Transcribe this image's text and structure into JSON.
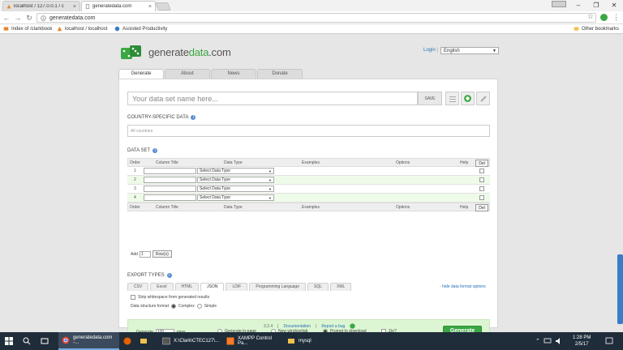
{
  "browser": {
    "tabs": [
      {
        "title": "localhost / 127.0.0.1 / c",
        "close": "×"
      },
      {
        "title": "generatedata.com",
        "close": "×"
      }
    ],
    "window_controls": {
      "minimize": "–",
      "maximize": "❐",
      "close": "✕"
    },
    "nav": {
      "back": "←",
      "forward": "→",
      "reload": "↻"
    },
    "url": "generatedata.com",
    "star": "☆",
    "menu": "⋮",
    "bookmarks": [
      {
        "label": "Index of /clarkbook"
      },
      {
        "label": "localhost / localhost"
      },
      {
        "label": "Assisted Productivity"
      }
    ],
    "other_bookmarks": "Other bookmarks"
  },
  "site": {
    "logo": {
      "prefix": "generate",
      "accent": "data",
      "suffix": ".com"
    },
    "login": "Login",
    "separator": "|",
    "language": "English",
    "nav_tabs": [
      "Generate",
      "About",
      "News",
      "Donate"
    ],
    "dataset_name_placeholder": "Your data set name here...",
    "save_label": "SAVE",
    "country_label": "COUNTRY-SPECIFIC DATA",
    "country_value": "All countries",
    "dataset_label": "DATA SET",
    "grid_headers": [
      "Order",
      "Column Title",
      "Data Type",
      "Examples",
      "Options",
      "Help",
      "Del"
    ],
    "rows": [
      {
        "order": "1",
        "type": "Select Data Type"
      },
      {
        "order": "2",
        "type": "Select Data Type"
      },
      {
        "order": "3",
        "type": "Select Data Type"
      },
      {
        "order": "4",
        "type": "Select Data Type"
      }
    ],
    "add_label": "Add",
    "add_count": "1",
    "rows_button": "Row(s)",
    "export_label": "EXPORT TYPES",
    "export_tabs": [
      "CSV",
      "Excel",
      "HTML",
      "JSON",
      "LDIF",
      "Programming Language",
      "SQL",
      "XML"
    ],
    "hide_options": "- hide data format options",
    "strip_whitespace": "Strip whitespace from generated results",
    "structure_label": "Data structure format",
    "structure_options": [
      "Complex",
      "Simple"
    ],
    "generate_label": "Generate",
    "generate_count": "100",
    "rows_label": "rows",
    "gen_options": [
      "Generate in-page",
      "New window/tab",
      "Prompt to download",
      "Zip?"
    ],
    "generate_button": "Generate",
    "footer": {
      "version": "3.2.4",
      "sep": "|",
      "docs": "Documentation",
      "report": "Report a bug"
    }
  },
  "taskbar": {
    "items": [
      "generatedata.com -...",
      "X:\\Clark\\CTEC127\\...",
      "XAMPP Control Pa...",
      "mysql"
    ],
    "time": "1:28 PM",
    "date": "2/5/17"
  },
  "colors": {
    "accent": "#3aa843",
    "link": "#2a6ebb",
    "taskbar": "#1f2c3a"
  }
}
